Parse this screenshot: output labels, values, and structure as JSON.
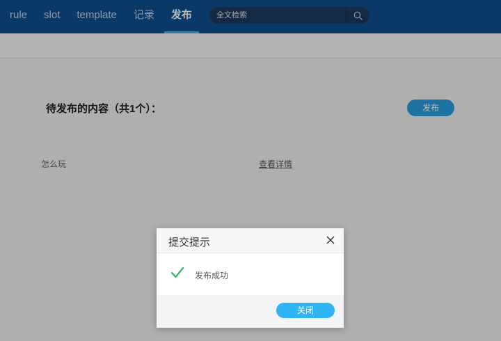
{
  "nav": {
    "items": [
      {
        "label": "rule"
      },
      {
        "label": "slot"
      },
      {
        "label": "template"
      },
      {
        "label": "记录"
      },
      {
        "label": "发布"
      }
    ],
    "active_index": 4
  },
  "search": {
    "placeholder": "全文检索",
    "icon": "search-icon"
  },
  "main": {
    "section_title": "待发布的内容（共1个）：",
    "publish_label": "发布",
    "items": [
      {
        "name": "怎么玩",
        "link_label": "查看详情"
      }
    ]
  },
  "modal": {
    "title": "提交提示",
    "message": "发布成功",
    "close_label": "关闭",
    "status_icon": "check-icon",
    "close_icon": "close-icon"
  },
  "colors": {
    "nav_bg": "#0c4f8f",
    "accent": "#2a9fe0",
    "success": "#3cb371"
  }
}
